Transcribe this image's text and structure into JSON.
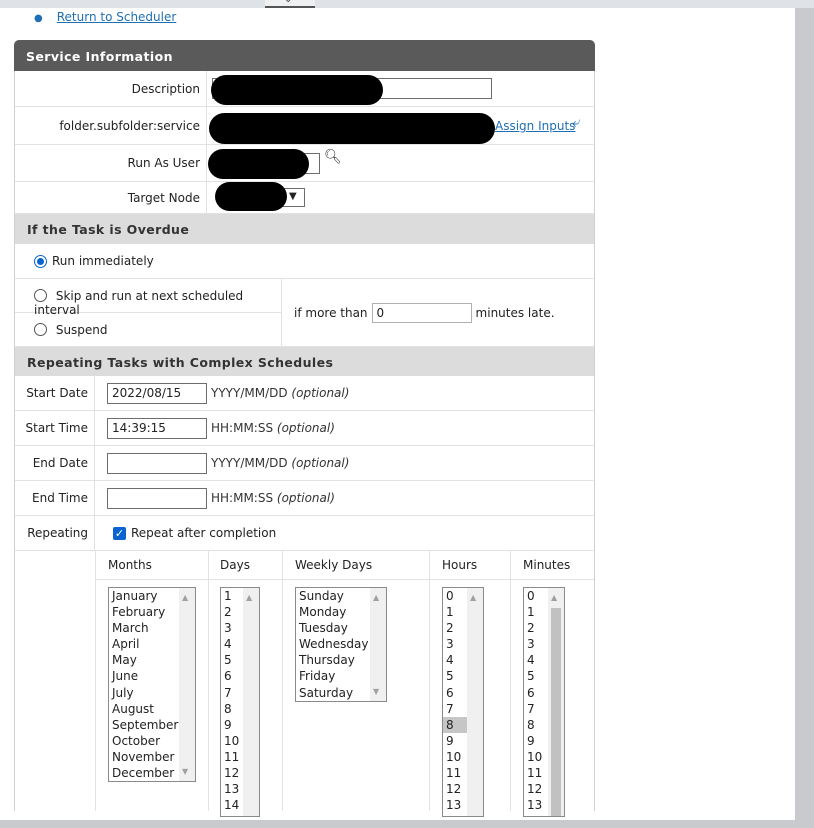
{
  "nav": {
    "return_link": "Return to Scheduler"
  },
  "service_info": {
    "header": "Service Information",
    "description_label": "Description",
    "service_label": "folder.subfolder:service",
    "assign_inputs": "Assign Inputs",
    "run_as_label": "Run As User",
    "target_node_label": "Target Node"
  },
  "overdue": {
    "header": "If the Task is Overdue",
    "run_immediately": "Run immediately",
    "skip": "Skip and run at next scheduled interval",
    "suspend": "Suspend",
    "if_more_than": "if more than",
    "minutes_value": "0",
    "minutes_late": "minutes late."
  },
  "repeating": {
    "header": "Repeating Tasks with Complex Schedules",
    "start_date_label": "Start Date",
    "start_date_value": "2022/08/15",
    "start_date_hint": "YYYY/MM/DD",
    "start_time_label": "Start Time",
    "start_time_value": "14:39:15",
    "start_time_hint": "HH:MM:SS",
    "end_date_label": "End Date",
    "end_date_hint": "YYYY/MM/DD",
    "end_time_label": "End Time",
    "end_time_hint": "HH:MM:SS",
    "optional": "(optional)",
    "repeating_label": "Repeating",
    "repeat_after": "Repeat after completion"
  },
  "columns": {
    "months": "Months",
    "days": "Days",
    "weekly": "Weekly Days",
    "hours": "Hours",
    "minutes": "Minutes"
  },
  "lists": {
    "months": [
      "January",
      "February",
      "March",
      "April",
      "May",
      "June",
      "July",
      "August",
      "September",
      "October",
      "November",
      "December"
    ],
    "days": [
      "1",
      "2",
      "3",
      "4",
      "5",
      "6",
      "7",
      "8",
      "9",
      "10",
      "11",
      "12",
      "13",
      "14"
    ],
    "weekly": [
      "Sunday",
      "Monday",
      "Tuesday",
      "Wednesday",
      "Thursday",
      "Friday",
      "Saturday"
    ],
    "hours": [
      "0",
      "1",
      "2",
      "3",
      "4",
      "5",
      "6",
      "7",
      "8",
      "9",
      "10",
      "11",
      "12",
      "13"
    ],
    "minutes": [
      "0",
      "1",
      "2",
      "3",
      "4",
      "5",
      "6",
      "7",
      "8",
      "9",
      "10",
      "11",
      "12",
      "13"
    ]
  },
  "selected_hour": "8",
  "colors": {
    "header_dark": "#5a5a5a",
    "header_light": "#dcdcdc",
    "link": "#1f6fb5",
    "accent": "#0a64d0"
  }
}
